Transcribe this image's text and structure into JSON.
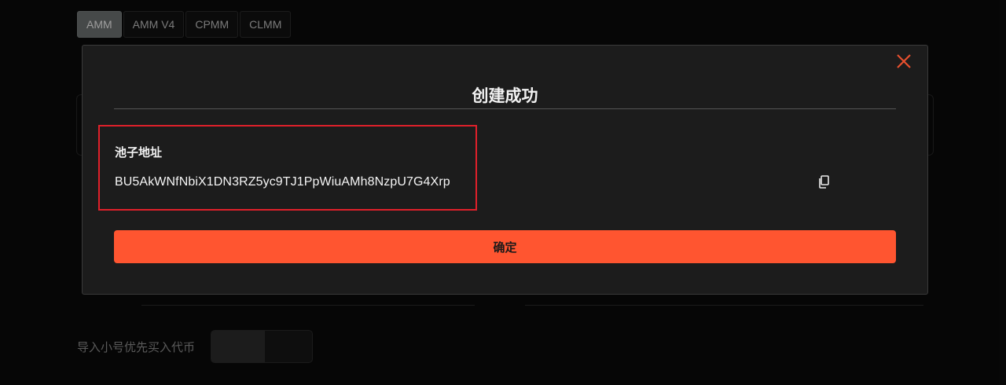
{
  "tabs": [
    {
      "label": "AMM",
      "active": true
    },
    {
      "label": "AMM V4",
      "active": false
    },
    {
      "label": "CPMM",
      "active": false
    },
    {
      "label": "CLMM",
      "active": false
    }
  ],
  "background_form": {
    "import_label": "导入小号优先买入代币"
  },
  "modal": {
    "title": "创建成功",
    "field_label": "池子地址",
    "pool_address": "BU5AkWNfNbiX1DN3RZ5yc9TJ1PpWiuAMh8NzpU7G4Xrp",
    "confirm_label": "确定",
    "close_icon": "close-icon",
    "copy_icon": "copy-icon"
  },
  "colors": {
    "accent": "#ff5530",
    "close_icon": "#e8502e",
    "highlight_border": "#e0202a",
    "modal_bg": "#1c1c1c",
    "page_bg": "#0a0a0a",
    "active_tab_bg": "#6c7070"
  }
}
